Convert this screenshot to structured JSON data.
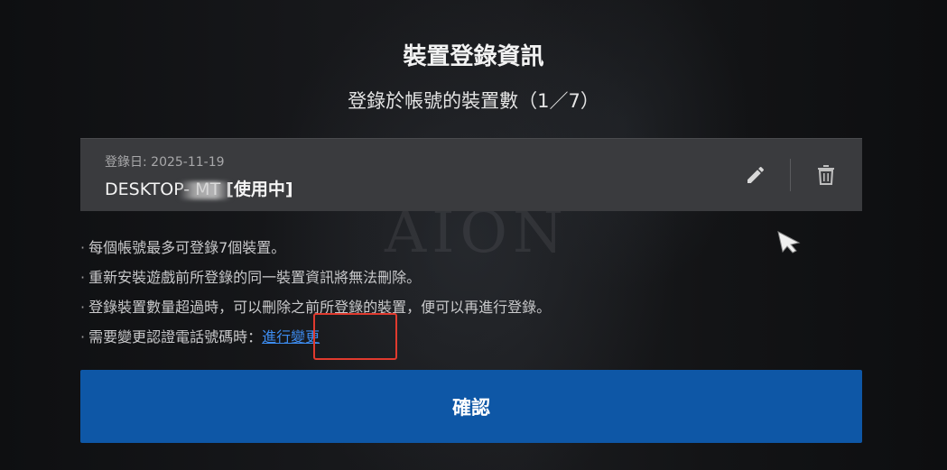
{
  "dialog": {
    "title": "裝置登錄資訊",
    "subtitle": "登錄於帳號的裝置數（1／7）"
  },
  "background": {
    "watermark": "AION"
  },
  "device": {
    "date": "登錄日: 2025-11-19",
    "name": "DESKTOP-       MT",
    "status": "[使用中]",
    "edit_icon": "pencil-icon",
    "delete_icon": "trash-icon"
  },
  "notes": [
    "每個帳號最多可登錄7個裝置。",
    "重新安裝遊戲前所登錄的同一裝置資訊將無法刪除。",
    "登錄裝置數量超過時，可以刪除之前所登錄的裝置，便可以再進行登錄。",
    "需要變更認證電話號碼時："
  ],
  "change_link": "進行變更",
  "confirm_button": "確認",
  "colors": {
    "accent_button": "#0e57a6",
    "link": "#3d8cf0",
    "highlight": "#e03a2e",
    "card": "#3a3b3e"
  }
}
